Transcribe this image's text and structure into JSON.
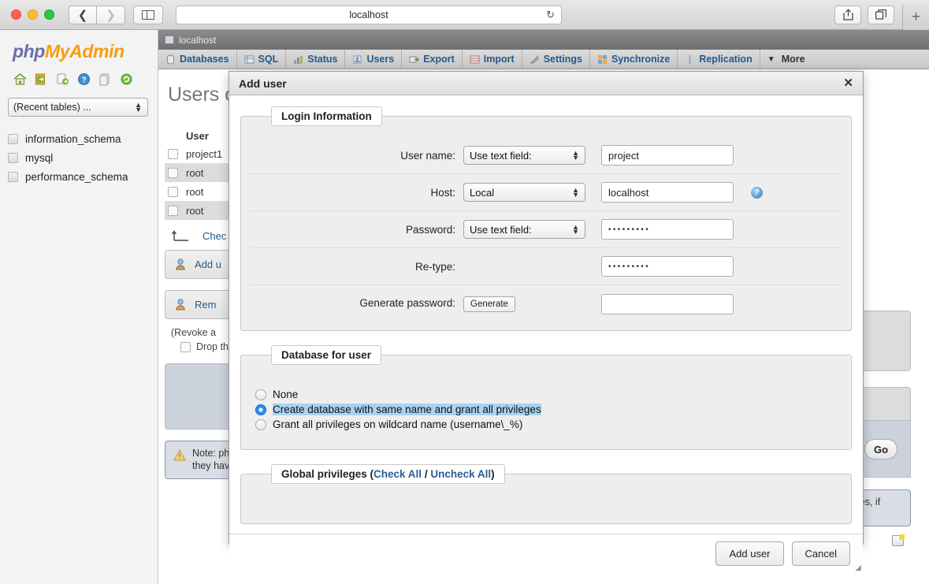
{
  "browser": {
    "url": "localhost",
    "back_icon": "chevron-left-icon",
    "forward_icon": "chevron-right-icon",
    "sidebar_icon": "sidebar-toggle-icon",
    "reload_icon": "reload-icon",
    "share_icon": "share-icon",
    "tabs_icon": "show-tabs-icon",
    "newtab_label": "+"
  },
  "sidebar": {
    "logo_php": "php",
    "logo_myadmin": "MyAdmin",
    "icons": [
      "home-icon",
      "logout-icon",
      "docs-icon",
      "help-icon",
      "wiki-icon",
      "reload-icon"
    ],
    "recent_select": "(Recent tables) ...",
    "databases": [
      "information_schema",
      "mysql",
      "performance_schema"
    ]
  },
  "main": {
    "server_breadcrumb": "localhost",
    "tabs": [
      {
        "label": "Databases",
        "icon": "database-icon"
      },
      {
        "label": "SQL",
        "icon": "sql-icon"
      },
      {
        "label": "Status",
        "icon": "status-icon"
      },
      {
        "label": "Users",
        "icon": "users-icon"
      },
      {
        "label": "Export",
        "icon": "export-icon"
      },
      {
        "label": "Import",
        "icon": "import-icon"
      },
      {
        "label": "Settings",
        "icon": "settings-icon"
      },
      {
        "label": "Synchronize",
        "icon": "synchronize-icon"
      },
      {
        "label": "Replication",
        "icon": "replication-icon"
      },
      {
        "label": "More",
        "icon": "chevron-down-icon"
      }
    ],
    "page_title": "Users o",
    "users_table": {
      "headers": [
        "User"
      ],
      "rows": [
        {
          "user": "project1"
        },
        {
          "user": "root"
        },
        {
          "user": "root"
        },
        {
          "user": "root"
        }
      ]
    },
    "check_all_label": "Chec",
    "add_user_label": "Add u",
    "remove_label": "Rem",
    "revoke_text": "(Revoke a",
    "drop_text": "Drop th",
    "go_label": "Go",
    "note_line1": "Note: php",
    "note_line2": "they have",
    "note_right": "er uses, if"
  },
  "dialog": {
    "title": "Add user",
    "close_icon": "close-icon",
    "login_legend": "Login Information",
    "fields": {
      "username_label": "User name:",
      "username_select": "Use text field:",
      "username_value": "project",
      "host_label": "Host:",
      "host_select": "Local",
      "host_value": "localhost",
      "host_help_icon": "help-icon",
      "password_label": "Password:",
      "password_select": "Use text field:",
      "password_value": "•••••••••",
      "retype_label": "Re-type:",
      "retype_value": "•••••••••",
      "generate_label": "Generate password:",
      "generate_button": "Generate",
      "generate_value": ""
    },
    "database_legend": "Database for user",
    "database_options": [
      {
        "label": "None",
        "selected": false,
        "highlighted": false
      },
      {
        "label": "Create database with same name and grant all privileges",
        "selected": true,
        "highlighted": true
      },
      {
        "label": "Grant all privileges on wildcard name (username\\_%)",
        "selected": false,
        "highlighted": false
      }
    ],
    "global_legend_prefix": "Global privileges (",
    "global_check_all": "Check All",
    "global_separator": " / ",
    "global_uncheck_all": "Uncheck All",
    "global_legend_suffix": ")",
    "submit_label": "Add user",
    "cancel_label": "Cancel"
  }
}
